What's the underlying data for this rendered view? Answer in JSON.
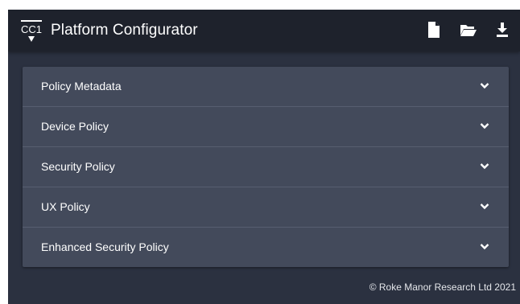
{
  "header": {
    "logo_text": "CC1",
    "title": "Platform Configurator",
    "actions": [
      {
        "icon": "file-icon",
        "label": "New"
      },
      {
        "icon": "folder-open-icon",
        "label": "Open"
      },
      {
        "icon": "download-icon",
        "label": "Download"
      }
    ]
  },
  "panels": [
    {
      "label": "Policy Metadata"
    },
    {
      "label": "Device Policy"
    },
    {
      "label": "Security Policy"
    },
    {
      "label": "UX Policy"
    },
    {
      "label": "Enhanced Security Policy"
    }
  ],
  "footer": {
    "copyright": "© Roke Manor Research Ltd 2021"
  },
  "colors": {
    "header_bg": "#1e222c",
    "app_bg": "#2b3140",
    "panel_bg": "#434a5b",
    "text": "#ffffff"
  }
}
